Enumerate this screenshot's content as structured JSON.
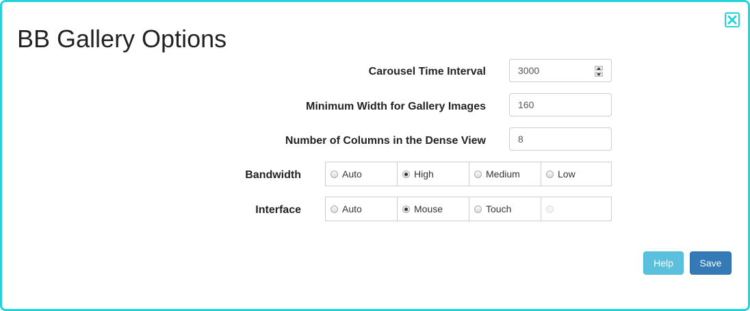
{
  "dialog": {
    "title": "BB Gallery Options",
    "close_icon": "close-x-icon",
    "accent_color": "#25d3da"
  },
  "fields": {
    "carousel_interval": {
      "label": "Carousel Time Interval",
      "value": "3000"
    },
    "min_width": {
      "label": "Minimum Width for Gallery Images",
      "value": "160"
    },
    "dense_columns": {
      "label": "Number of Columns in the Dense View",
      "value": "8"
    }
  },
  "bandwidth": {
    "label": "Bandwidth",
    "options": [
      "Auto",
      "High",
      "Medium",
      "Low"
    ],
    "selected": "High"
  },
  "interface": {
    "label": "Interface",
    "options": [
      "Auto",
      "Mouse",
      "Touch",
      ""
    ],
    "selected": "Mouse"
  },
  "buttons": {
    "help": "Help",
    "save": "Save",
    "help_color": "#5bc0de",
    "save_color": "#337ab7"
  }
}
